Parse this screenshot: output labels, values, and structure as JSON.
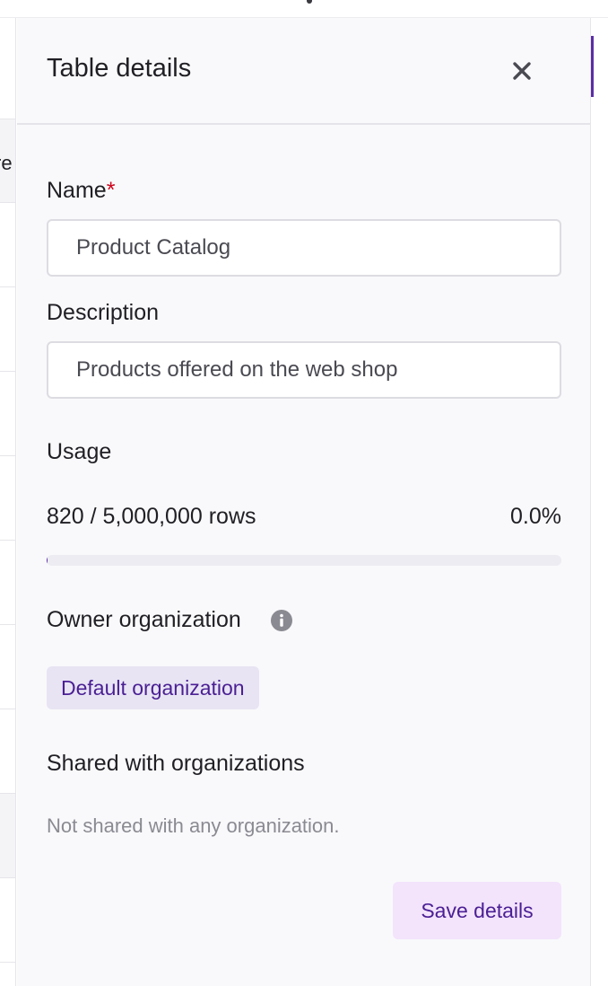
{
  "background_table": {
    "header_text_fragment": "re"
  },
  "panel": {
    "title": "Table details",
    "close_icon": "close-icon",
    "name": {
      "label": "Name",
      "required_marker": "*",
      "value": "Product Catalog"
    },
    "description": {
      "label": "Description",
      "value": "Products offered on the web shop"
    },
    "usage": {
      "label": "Usage",
      "rows_text": "820 / 5,000,000 rows",
      "percent_text": "0.0%",
      "progress_percent": 0.0164
    },
    "owner_organization": {
      "label": "Owner organization",
      "info_icon": "info-icon",
      "value": "Default organization"
    },
    "shared_with": {
      "label": "Shared with organizations",
      "empty_text": "Not shared with any organization."
    },
    "save_label": "Save details"
  },
  "colors": {
    "accent": "#5b2ea6",
    "chip_bg": "#e8e4f3",
    "chip_text": "#4a1f94",
    "save_bg": "#f3e3fb",
    "required": "#d0021b"
  }
}
